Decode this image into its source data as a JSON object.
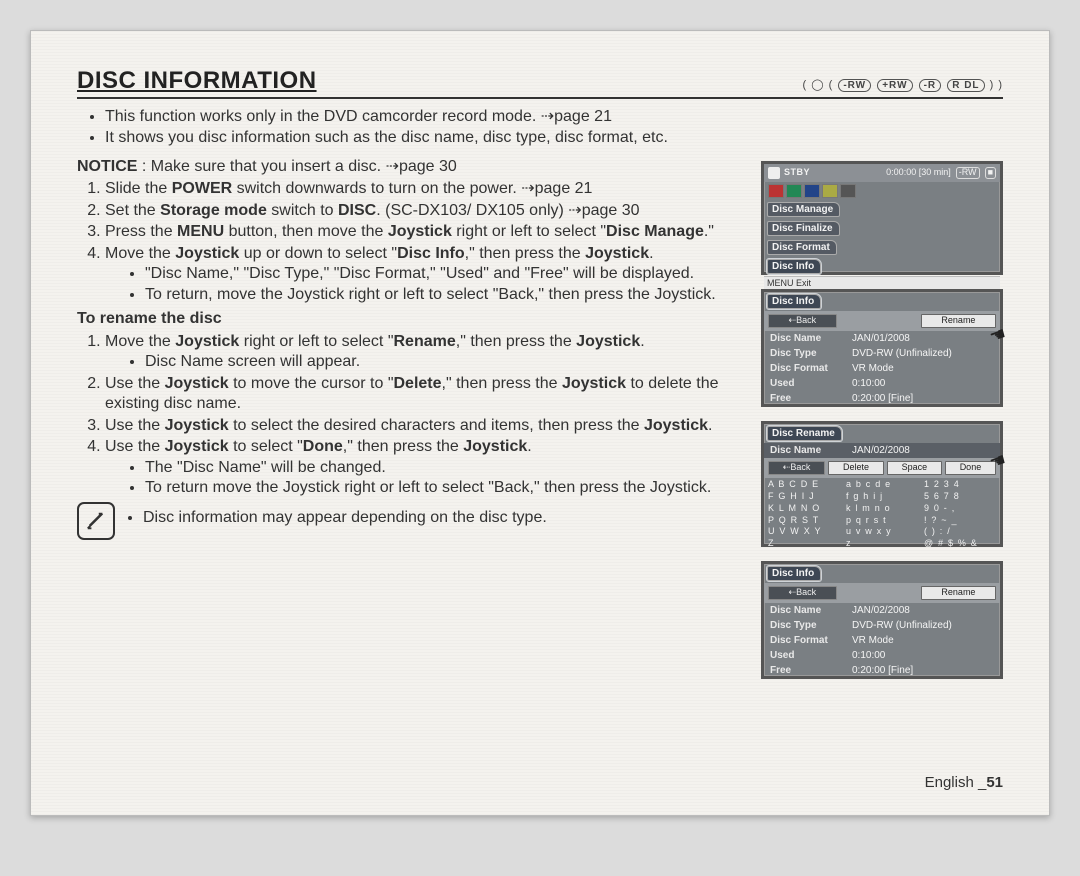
{
  "title": "DISC INFORMATION",
  "badges": [
    "-RW",
    "+RW",
    "-R",
    "R DL"
  ],
  "intro_bullets": [
    "This function works only in the DVD camcorder record mode. ⇢page 21",
    "It shows you disc information such as the disc name, disc type, disc format, etc."
  ],
  "notice_label": "NOTICE",
  "notice_text": " : Make sure that you insert a disc. ⇢page 30",
  "steps_a": {
    "s1_pre": "Slide the ",
    "s1_b1": "POWER",
    "s1_post": " switch downwards to turn on the power. ⇢page 21",
    "s2_pre": "Set the ",
    "s2_b1": "Storage mode",
    "s2_mid": " switch to ",
    "s2_b2": "DISC",
    "s2_post": ". (SC-DX103/ DX105 only) ⇢page 30",
    "s3_pre": "Press the ",
    "s3_b1": "MENU",
    "s3_mid": " button, then move the ",
    "s3_b2": "Joystick",
    "s3_post": " right or left to select \"",
    "s3_b3": "Disc Manage",
    "s3_end": ".\"",
    "s4_pre": "Move the ",
    "s4_b1": "Joystick",
    "s4_mid": " up or down to select \"",
    "s4_b2": "Disc Info",
    "s4_mid2": ",\" then press the ",
    "s4_b3": "Joystick",
    "s4_end": "."
  },
  "steps_a_sub": [
    "\"Disc Name,\" \"Disc Type,\" \"Disc Format,\" \"Used\" and \"Free\" will be displayed.",
    "To return, move the Joystick right or left to select \"Back,\" then press the Joystick."
  ],
  "rename_heading": "To rename the disc",
  "steps_b": {
    "s1_pre": "Move the ",
    "s1_b1": "Joystick",
    "s1_mid": " right or left to select \"",
    "s1_b2": "Rename",
    "s1_mid2": ",\" then press the ",
    "s1_b3": "Joystick",
    "s1_end": ".",
    "s1_sub": "Disc Name screen will appear.",
    "s2_pre": "Use the ",
    "s2_b1": "Joystick",
    "s2_mid": " to move the cursor to \"",
    "s2_b2": "Delete",
    "s2_mid2": ",\" then press the ",
    "s2_b3": "Joystick",
    "s2_post": " to delete the existing disc name.",
    "s3_pre": "Use the ",
    "s3_b1": "Joystick",
    "s3_mid": " to select the desired characters and items, then press the ",
    "s3_b2": "Joystick",
    "s3_end": ".",
    "s4_pre": "Use the ",
    "s4_b1": "Joystick",
    "s4_mid": " to select \"",
    "s4_b2": "Done",
    "s4_mid2": ",\" then press the ",
    "s4_b3": "Joystick",
    "s4_end": ".",
    "s4_sub1": "The \"Disc Name\" will be changed.",
    "s4_sub2": "To return move the Joystick right or left to select \"Back,\" then press the Joystick."
  },
  "note_text": "Disc information may appear depending on the disc type.",
  "footer_label": "English _",
  "footer_page": "51",
  "shot1": {
    "stby": "STBY",
    "runtime": "0:00:00 [30 min]",
    "tabs": [
      "Disc Manage",
      "Disc Finalize",
      "Disc Format",
      "Disc Info"
    ],
    "menu": "MENU  Exit"
  },
  "shot2": {
    "title": "Disc Info",
    "btn_back": "⇠Back",
    "btn_rename": "Rename",
    "rows": [
      [
        "Disc Name",
        "JAN/01/2008"
      ],
      [
        "Disc Type",
        "DVD-RW (Unfinalized)"
      ],
      [
        "Disc Format",
        "VR Mode"
      ],
      [
        "Used",
        "0:10:00"
      ],
      [
        "Free",
        "0:20:00 [Fine]"
      ]
    ]
  },
  "shot3": {
    "title": "Disc Rename",
    "name_label": "Disc Name",
    "name_value": "JAN/02/2008",
    "btns": [
      "⇠Back",
      "Delete",
      "Space",
      "Done"
    ],
    "kbd": [
      "A B C D E",
      "a b c d e",
      "1 2 3 4",
      "F G H I J",
      "f g h i j",
      "5 6 7 8",
      "K L M N O",
      "k l m n o",
      "9 0 - ,",
      "P Q R S T",
      "p q r s t",
      "! ? ~ _",
      "U V W X Y",
      "u v w x y",
      "( ) : /",
      "Z",
      "z",
      "@ # $ % &"
    ]
  },
  "shot4": {
    "title": "Disc Info",
    "btn_back": "⇠Back",
    "btn_rename": "Rename",
    "rows": [
      [
        "Disc Name",
        "JAN/02/2008"
      ],
      [
        "Disc Type",
        "DVD-RW (Unfinalized)"
      ],
      [
        "Disc Format",
        "VR Mode"
      ],
      [
        "Used",
        "0:10:00"
      ],
      [
        "Free",
        "0:20:00 [Fine]"
      ]
    ]
  }
}
